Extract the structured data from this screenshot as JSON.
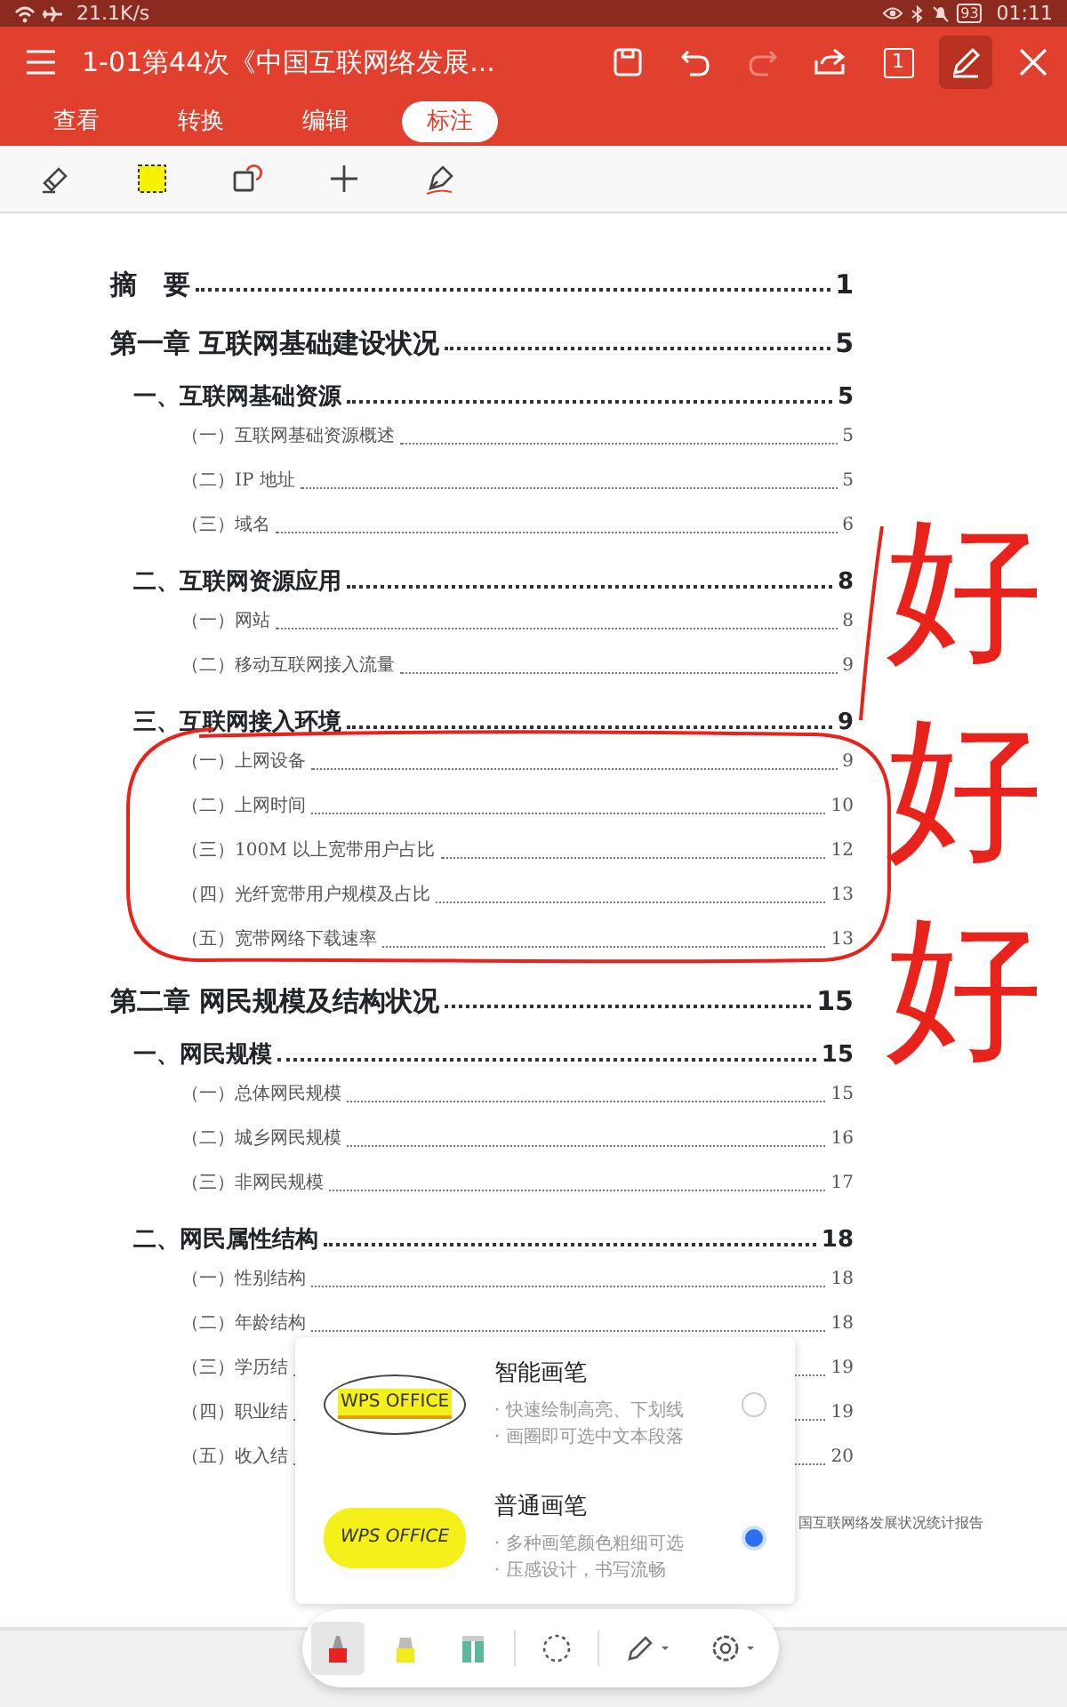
{
  "status_bar": {
    "network_speed": "21.1K/s",
    "battery": "93",
    "time": "01:11"
  },
  "title_bar": {
    "title": "1-01第44次《中国互联网络发展...",
    "redo_disabled": true,
    "page_number": "1",
    "pen_selected": true
  },
  "tabs": [
    {
      "label": "查看",
      "selected": false
    },
    {
      "label": "转换",
      "selected": false
    },
    {
      "label": "编辑",
      "selected": false
    },
    {
      "label": "标注",
      "selected": true
    }
  ],
  "toc": [
    {
      "kind": "chapter",
      "title": "摘　要",
      "page": "1"
    },
    {
      "kind": "chapter",
      "title": "第一章  互联网基础建设状况",
      "page": "5"
    },
    {
      "kind": "section",
      "title": "一、互联网基础资源",
      "page": "5"
    },
    {
      "kind": "sub",
      "title": "（一）互联网基础资源概述",
      "page": "5"
    },
    {
      "kind": "sub",
      "title": "（二）IP 地址",
      "page": "5"
    },
    {
      "kind": "sub",
      "title": "（三）域名",
      "page": "6"
    },
    {
      "kind": "section",
      "title": "二、互联网资源应用",
      "page": "8"
    },
    {
      "kind": "sub",
      "title": "（一）网站",
      "page": "8"
    },
    {
      "kind": "sub",
      "title": "（二）移动互联网接入流量",
      "page": "9"
    },
    {
      "kind": "section",
      "title": "三、互联网接入环境",
      "page": "9"
    },
    {
      "kind": "sub",
      "title": "（一）上网设备",
      "page": "9"
    },
    {
      "kind": "sub",
      "title": "（二）上网时间",
      "page": "10"
    },
    {
      "kind": "sub",
      "title": "（三）100M 以上宽带用户占比",
      "page": "12"
    },
    {
      "kind": "sub",
      "title": "（四）光纤宽带用户规模及占比",
      "page": "13"
    },
    {
      "kind": "sub",
      "title": "（五）宽带网络下载速率",
      "page": "13"
    },
    {
      "kind": "chapter",
      "title": "第二章  网民规模及结构状况",
      "page": "15"
    },
    {
      "kind": "section",
      "title": "一、网民规模",
      "page": "15"
    },
    {
      "kind": "sub",
      "title": "（一）总体网民规模",
      "page": "15"
    },
    {
      "kind": "sub",
      "title": "（二）城乡网民规模",
      "page": "16"
    },
    {
      "kind": "sub",
      "title": "（三）非网民规模",
      "page": "17"
    },
    {
      "kind": "section",
      "title": "二、网民属性结构",
      "page": "18"
    },
    {
      "kind": "sub",
      "title": "（一）性别结构",
      "page": "18"
    },
    {
      "kind": "sub",
      "title": "（二）年龄结构",
      "page": "18"
    },
    {
      "kind": "sub",
      "title": "（三）学历结",
      "page": "19"
    },
    {
      "kind": "sub",
      "title": "（四）职业结",
      "page": "19"
    },
    {
      "kind": "sub",
      "title": "（五）收入结",
      "page": "20"
    }
  ],
  "page_footer": "国互联网络发展状况统计报告",
  "handwriting": [
    "好",
    "好",
    "好"
  ],
  "pen_popup": {
    "options": [
      {
        "kind": "smart",
        "preview_text": "WPS OFFICE",
        "title": "智能画笔",
        "lines": [
          "· 快速绘制高亮、下划线",
          "· 画圈即可选中文本段落"
        ],
        "selected": false
      },
      {
        "kind": "normal",
        "preview_text": "WPS OFFICE",
        "title": "普通画笔",
        "lines": [
          "· 多种画笔颜色粗细可选",
          "· 压感设计，书写流畅"
        ],
        "selected": true
      }
    ]
  },
  "bottom_toolbar": [
    {
      "kind": "marker",
      "color": "#e52421",
      "selected": true
    },
    {
      "kind": "highlighter",
      "color": "#f2ea1c",
      "selected": false
    },
    {
      "kind": "tape",
      "color": "#5cb89c",
      "selected": false
    },
    {
      "kind": "lasso",
      "selected": false
    },
    {
      "kind": "pen-menu",
      "selected": false
    },
    {
      "kind": "settings-menu",
      "selected": false
    }
  ]
}
